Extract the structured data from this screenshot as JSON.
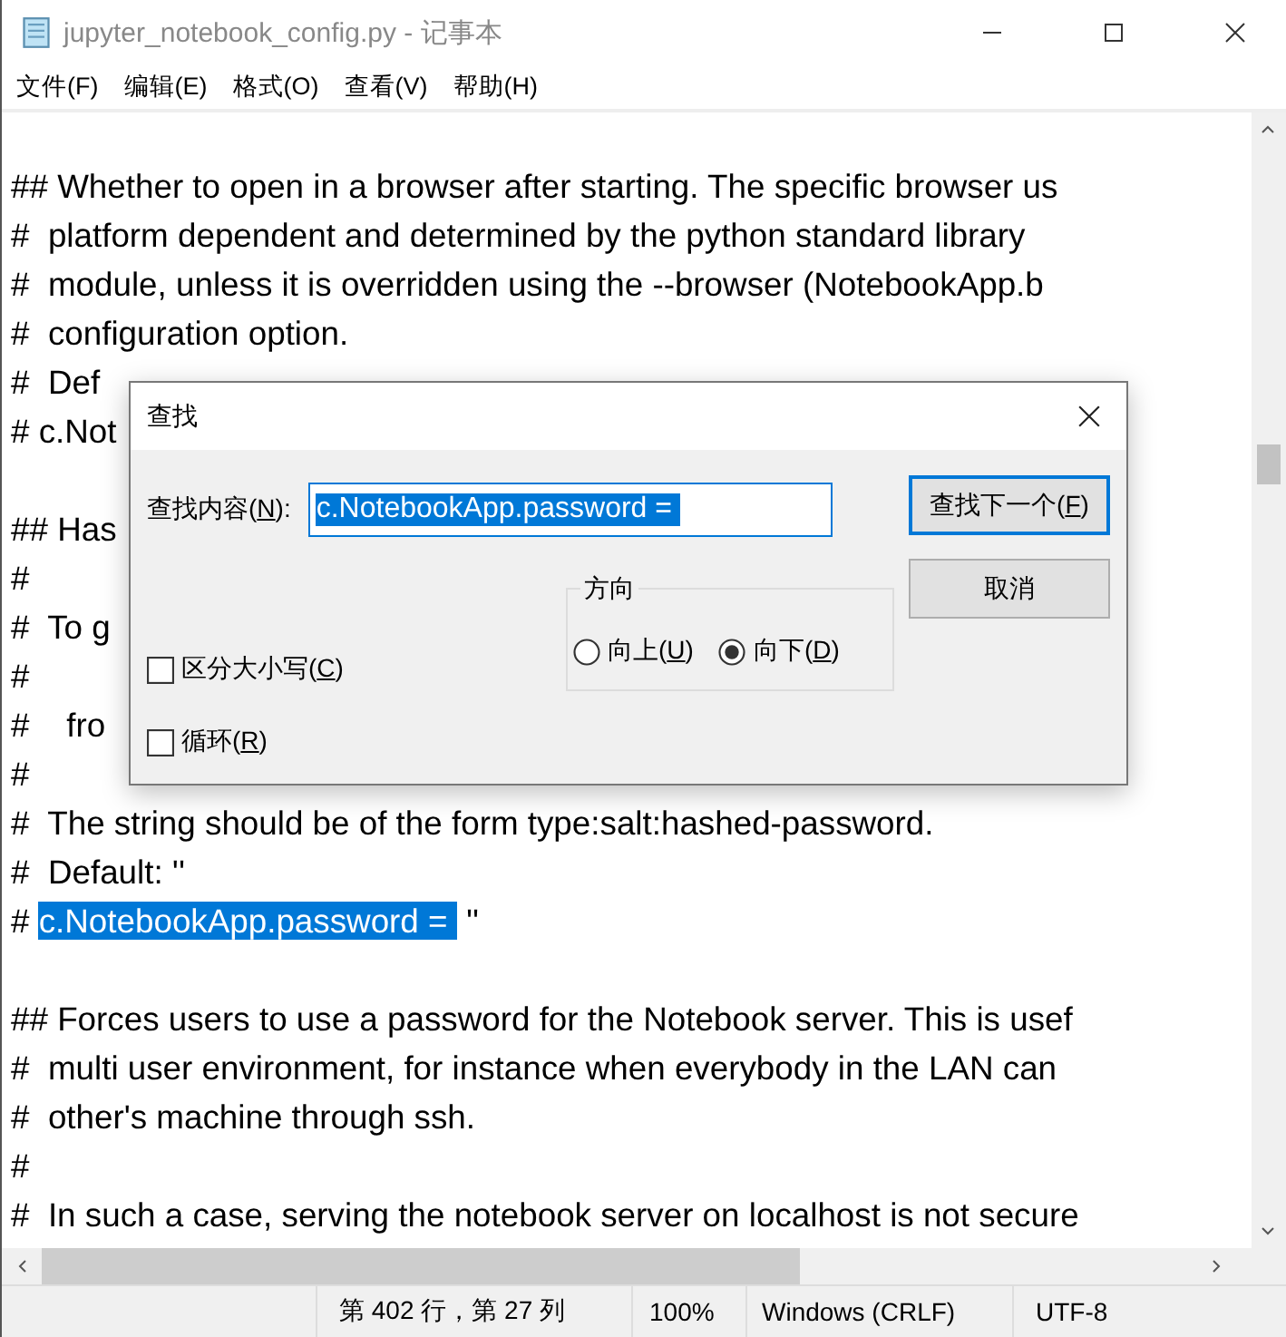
{
  "window": {
    "title": "jupyter_notebook_config.py - 记事本"
  },
  "menu": [
    "文件(F)",
    "编辑(E)",
    "格式(O)",
    "查看(V)",
    "帮助(H)"
  ],
  "lines": [
    {
      "text": "## Whether to open in a browser after starting. The specific browser us"
    },
    {
      "text": "#  platform dependent and determined by the python standard library"
    },
    {
      "text": "#  module, unless it is overridden using the --browser (NotebookApp.b"
    },
    {
      "text": "#  configuration option."
    },
    {
      "text": "#  Def"
    },
    {
      "text": "# c.Not"
    },
    {
      "text": "## Has",
      "gap_before": true
    },
    {
      "text": "#"
    },
    {
      "text": "#  To g"
    },
    {
      "text": "#"
    },
    {
      "text": "#    fro"
    },
    {
      "text": "#"
    },
    {
      "text": "#  The string should be of the form type:salt:hashed-password."
    },
    {
      "text": "#  Default: ''"
    },
    {
      "text": "# ",
      "selected_text": "c.NotebookApp.password =",
      "after": " ''"
    },
    {
      "gap_before": true,
      "text": "## Forces users to use a password for the Notebook server. This is usef"
    },
    {
      "text": "#  multi user environment, for instance when everybody in the LAN can"
    },
    {
      "text": "#  other's machine through ssh."
    },
    {
      "text": "#"
    },
    {
      "text": "#  In such a case, serving the notebook server on localhost is not secure"
    }
  ],
  "status_bar": [
    "第 402 行，第 27 列",
    "100%",
    "Windows (CRLF)",
    "UTF-8"
  ],
  "find_dialog": {
    "title": "查找",
    "find_label": {
      "before": "查找内容(",
      "key": "N",
      "after": "):"
    },
    "find_value": "c.NotebookApp.password =",
    "buttons": [
      {
        "before": "查找下一个(",
        "key": "F",
        "after": ")",
        "default": true
      },
      {
        "before": "取消",
        "default": false
      }
    ],
    "direction": {
      "legend": "方向",
      "options": [
        {
          "before": "向上(",
          "key": "U",
          "after": ")",
          "selected": false
        },
        {
          "before": "向下(",
          "key": "D",
          "after": ")",
          "selected": true
        }
      ]
    },
    "checkboxes": [
      {
        "before": "区分大小写(",
        "key": "C",
        "after": ")",
        "checked": false
      },
      {
        "before": "循环(",
        "key": "R",
        "after": ")",
        "checked": false
      }
    ]
  }
}
